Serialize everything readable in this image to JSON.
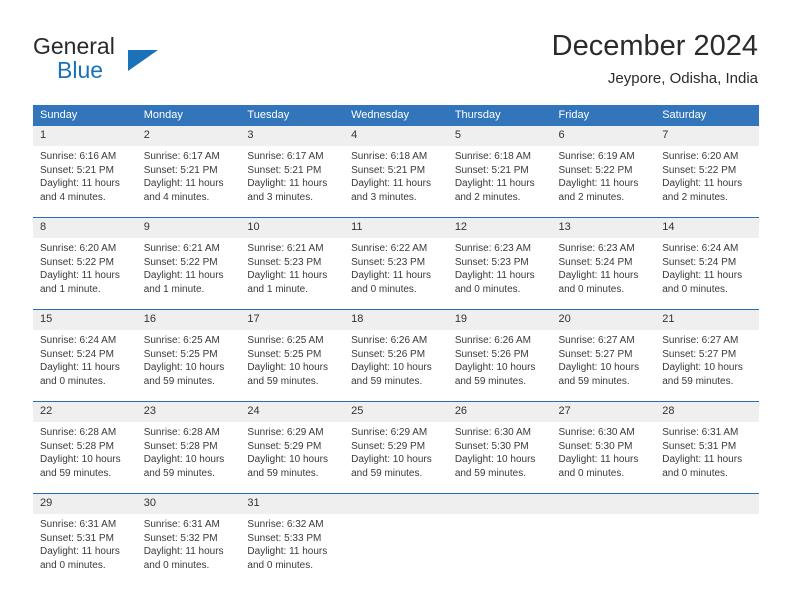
{
  "brand": {
    "word_one": "General",
    "word_two": "Blue",
    "accent_color": "#1b72b8",
    "logo_icon": "triangle-icon"
  },
  "header": {
    "title": "December 2024",
    "subtitle": "Jeypore, Odisha, India"
  },
  "calendar": {
    "header_bg": "#3275bb",
    "daynum_bg": "#efefef",
    "row_divider_color": "#2a6db5",
    "weekdays": [
      "Sunday",
      "Monday",
      "Tuesday",
      "Wednesday",
      "Thursday",
      "Friday",
      "Saturday"
    ],
    "weeks": [
      [
        {
          "day": "1",
          "sunrise": "Sunrise: 6:16 AM",
          "sunset": "Sunset: 5:21 PM",
          "daylight_line1": "Daylight: 11 hours",
          "daylight_line2": "and 4 minutes."
        },
        {
          "day": "2",
          "sunrise": "Sunrise: 6:17 AM",
          "sunset": "Sunset: 5:21 PM",
          "daylight_line1": "Daylight: 11 hours",
          "daylight_line2": "and 4 minutes."
        },
        {
          "day": "3",
          "sunrise": "Sunrise: 6:17 AM",
          "sunset": "Sunset: 5:21 PM",
          "daylight_line1": "Daylight: 11 hours",
          "daylight_line2": "and 3 minutes."
        },
        {
          "day": "4",
          "sunrise": "Sunrise: 6:18 AM",
          "sunset": "Sunset: 5:21 PM",
          "daylight_line1": "Daylight: 11 hours",
          "daylight_line2": "and 3 minutes."
        },
        {
          "day": "5",
          "sunrise": "Sunrise: 6:18 AM",
          "sunset": "Sunset: 5:21 PM",
          "daylight_line1": "Daylight: 11 hours",
          "daylight_line2": "and 2 minutes."
        },
        {
          "day": "6",
          "sunrise": "Sunrise: 6:19 AM",
          "sunset": "Sunset: 5:22 PM",
          "daylight_line1": "Daylight: 11 hours",
          "daylight_line2": "and 2 minutes."
        },
        {
          "day": "7",
          "sunrise": "Sunrise: 6:20 AM",
          "sunset": "Sunset: 5:22 PM",
          "daylight_line1": "Daylight: 11 hours",
          "daylight_line2": "and 2 minutes."
        }
      ],
      [
        {
          "day": "8",
          "sunrise": "Sunrise: 6:20 AM",
          "sunset": "Sunset: 5:22 PM",
          "daylight_line1": "Daylight: 11 hours",
          "daylight_line2": "and 1 minute."
        },
        {
          "day": "9",
          "sunrise": "Sunrise: 6:21 AM",
          "sunset": "Sunset: 5:22 PM",
          "daylight_line1": "Daylight: 11 hours",
          "daylight_line2": "and 1 minute."
        },
        {
          "day": "10",
          "sunrise": "Sunrise: 6:21 AM",
          "sunset": "Sunset: 5:23 PM",
          "daylight_line1": "Daylight: 11 hours",
          "daylight_line2": "and 1 minute."
        },
        {
          "day": "11",
          "sunrise": "Sunrise: 6:22 AM",
          "sunset": "Sunset: 5:23 PM",
          "daylight_line1": "Daylight: 11 hours",
          "daylight_line2": "and 0 minutes."
        },
        {
          "day": "12",
          "sunrise": "Sunrise: 6:23 AM",
          "sunset": "Sunset: 5:23 PM",
          "daylight_line1": "Daylight: 11 hours",
          "daylight_line2": "and 0 minutes."
        },
        {
          "day": "13",
          "sunrise": "Sunrise: 6:23 AM",
          "sunset": "Sunset: 5:24 PM",
          "daylight_line1": "Daylight: 11 hours",
          "daylight_line2": "and 0 minutes."
        },
        {
          "day": "14",
          "sunrise": "Sunrise: 6:24 AM",
          "sunset": "Sunset: 5:24 PM",
          "daylight_line1": "Daylight: 11 hours",
          "daylight_line2": "and 0 minutes."
        }
      ],
      [
        {
          "day": "15",
          "sunrise": "Sunrise: 6:24 AM",
          "sunset": "Sunset: 5:24 PM",
          "daylight_line1": "Daylight: 11 hours",
          "daylight_line2": "and 0 minutes."
        },
        {
          "day": "16",
          "sunrise": "Sunrise: 6:25 AM",
          "sunset": "Sunset: 5:25 PM",
          "daylight_line1": "Daylight: 10 hours",
          "daylight_line2": "and 59 minutes."
        },
        {
          "day": "17",
          "sunrise": "Sunrise: 6:25 AM",
          "sunset": "Sunset: 5:25 PM",
          "daylight_line1": "Daylight: 10 hours",
          "daylight_line2": "and 59 minutes."
        },
        {
          "day": "18",
          "sunrise": "Sunrise: 6:26 AM",
          "sunset": "Sunset: 5:26 PM",
          "daylight_line1": "Daylight: 10 hours",
          "daylight_line2": "and 59 minutes."
        },
        {
          "day": "19",
          "sunrise": "Sunrise: 6:26 AM",
          "sunset": "Sunset: 5:26 PM",
          "daylight_line1": "Daylight: 10 hours",
          "daylight_line2": "and 59 minutes."
        },
        {
          "day": "20",
          "sunrise": "Sunrise: 6:27 AM",
          "sunset": "Sunset: 5:27 PM",
          "daylight_line1": "Daylight: 10 hours",
          "daylight_line2": "and 59 minutes."
        },
        {
          "day": "21",
          "sunrise": "Sunrise: 6:27 AM",
          "sunset": "Sunset: 5:27 PM",
          "daylight_line1": "Daylight: 10 hours",
          "daylight_line2": "and 59 minutes."
        }
      ],
      [
        {
          "day": "22",
          "sunrise": "Sunrise: 6:28 AM",
          "sunset": "Sunset: 5:28 PM",
          "daylight_line1": "Daylight: 10 hours",
          "daylight_line2": "and 59 minutes."
        },
        {
          "day": "23",
          "sunrise": "Sunrise: 6:28 AM",
          "sunset": "Sunset: 5:28 PM",
          "daylight_line1": "Daylight: 10 hours",
          "daylight_line2": "and 59 minutes."
        },
        {
          "day": "24",
          "sunrise": "Sunrise: 6:29 AM",
          "sunset": "Sunset: 5:29 PM",
          "daylight_line1": "Daylight: 10 hours",
          "daylight_line2": "and 59 minutes."
        },
        {
          "day": "25",
          "sunrise": "Sunrise: 6:29 AM",
          "sunset": "Sunset: 5:29 PM",
          "daylight_line1": "Daylight: 10 hours",
          "daylight_line2": "and 59 minutes."
        },
        {
          "day": "26",
          "sunrise": "Sunrise: 6:30 AM",
          "sunset": "Sunset: 5:30 PM",
          "daylight_line1": "Daylight: 10 hours",
          "daylight_line2": "and 59 minutes."
        },
        {
          "day": "27",
          "sunrise": "Sunrise: 6:30 AM",
          "sunset": "Sunset: 5:30 PM",
          "daylight_line1": "Daylight: 11 hours",
          "daylight_line2": "and 0 minutes."
        },
        {
          "day": "28",
          "sunrise": "Sunrise: 6:31 AM",
          "sunset": "Sunset: 5:31 PM",
          "daylight_line1": "Daylight: 11 hours",
          "daylight_line2": "and 0 minutes."
        }
      ],
      [
        {
          "day": "29",
          "sunrise": "Sunrise: 6:31 AM",
          "sunset": "Sunset: 5:31 PM",
          "daylight_line1": "Daylight: 11 hours",
          "daylight_line2": "and 0 minutes."
        },
        {
          "day": "30",
          "sunrise": "Sunrise: 6:31 AM",
          "sunset": "Sunset: 5:32 PM",
          "daylight_line1": "Daylight: 11 hours",
          "daylight_line2": "and 0 minutes."
        },
        {
          "day": "31",
          "sunrise": "Sunrise: 6:32 AM",
          "sunset": "Sunset: 5:33 PM",
          "daylight_line1": "Daylight: 11 hours",
          "daylight_line2": "and 0 minutes."
        },
        {
          "day": "",
          "sunrise": "",
          "sunset": "",
          "daylight_line1": "",
          "daylight_line2": ""
        },
        {
          "day": "",
          "sunrise": "",
          "sunset": "",
          "daylight_line1": "",
          "daylight_line2": ""
        },
        {
          "day": "",
          "sunrise": "",
          "sunset": "",
          "daylight_line1": "",
          "daylight_line2": ""
        },
        {
          "day": "",
          "sunrise": "",
          "sunset": "",
          "daylight_line1": "",
          "daylight_line2": ""
        }
      ]
    ]
  }
}
